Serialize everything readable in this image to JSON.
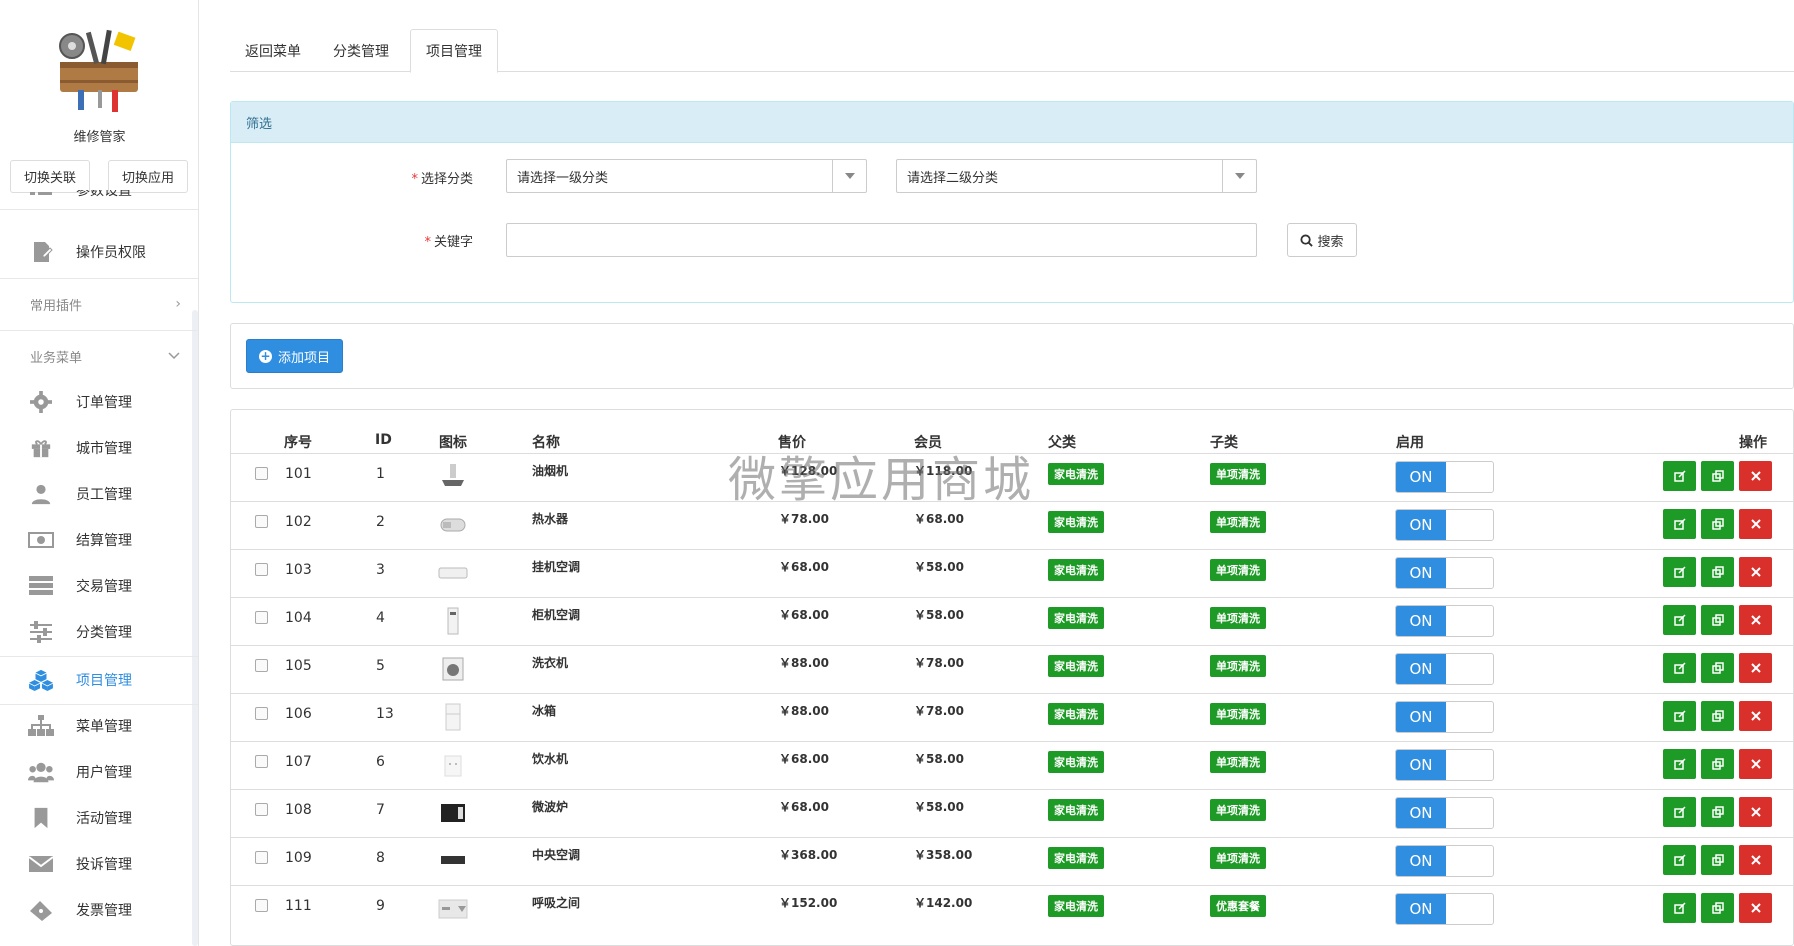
{
  "app": {
    "name": "维修管家"
  },
  "sidebar": {
    "switch_link_label": "切换关联",
    "switch_app_label": "切换应用",
    "partial_label": "参数设置",
    "top_items": [
      {
        "label": "操作员权限",
        "icon": "document-edit-icon"
      }
    ],
    "group_plugins": "常用插件",
    "group_business": "业务菜单",
    "items": [
      {
        "label": "订单管理",
        "icon": "gear-icon"
      },
      {
        "label": "城市管理",
        "icon": "gift-icon"
      },
      {
        "label": "员工管理",
        "icon": "user-icon"
      },
      {
        "label": "结算管理",
        "icon": "money-icon"
      },
      {
        "label": "交易管理",
        "icon": "server-icon"
      },
      {
        "label": "分类管理",
        "icon": "sliders-icon"
      },
      {
        "label": "项目管理",
        "icon": "cubes-icon"
      },
      {
        "label": "菜单管理",
        "icon": "sitemap-icon"
      },
      {
        "label": "用户管理",
        "icon": "users-icon"
      },
      {
        "label": "活动管理",
        "icon": "bookmark-icon"
      },
      {
        "label": "投诉管理",
        "icon": "envelope-icon"
      },
      {
        "label": "发票管理",
        "icon": "ticket-icon"
      }
    ],
    "active_color": "#2f8ee0"
  },
  "tabs": [
    "返回菜单",
    "分类管理",
    "项目管理"
  ],
  "filter": {
    "title": "筛选",
    "category_label": "选择分类",
    "category1_placeholder": "请选择一级分类",
    "category2_placeholder": "请选择二级分类",
    "keyword_label": "关键字",
    "keyword_value": "",
    "search_label": "搜索"
  },
  "actions": {
    "add_label": "添加项目"
  },
  "table": {
    "headers": {
      "seq": "序号",
      "id": "ID",
      "icon": "图标",
      "name": "名称",
      "price": "售价",
      "member": "会员",
      "parent": "父类",
      "child": "子类",
      "enabled": "启用",
      "ops": "操作"
    },
    "toggle_on": "ON",
    "rows": [
      {
        "seq": "101",
        "id": "1",
        "name": "油烟机",
        "price": "￥128.00",
        "member": "￥118.00",
        "parent": "家电清洗",
        "child": "单项清洗",
        "icon": "range-hood-icon"
      },
      {
        "seq": "102",
        "id": "2",
        "name": "热水器",
        "price": "￥78.00",
        "member": "￥68.00",
        "parent": "家电清洗",
        "child": "单项清洗",
        "icon": "water-heater-icon"
      },
      {
        "seq": "103",
        "id": "3",
        "name": "挂机空调",
        "price": "￥68.00",
        "member": "￥58.00",
        "parent": "家电清洗",
        "child": "单项清洗",
        "icon": "wall-ac-icon"
      },
      {
        "seq": "104",
        "id": "4",
        "name": "柜机空调",
        "price": "￥68.00",
        "member": "￥58.00",
        "parent": "家电清洗",
        "child": "单项清洗",
        "icon": "floor-ac-icon"
      },
      {
        "seq": "105",
        "id": "5",
        "name": "洗衣机",
        "price": "￥88.00",
        "member": "￥78.00",
        "parent": "家电清洗",
        "child": "单项清洗",
        "icon": "washer-icon"
      },
      {
        "seq": "106",
        "id": "13",
        "name": "冰箱",
        "price": "￥88.00",
        "member": "￥78.00",
        "parent": "家电清洗",
        "child": "单项清洗",
        "icon": "fridge-icon"
      },
      {
        "seq": "107",
        "id": "6",
        "name": "饮水机",
        "price": "￥68.00",
        "member": "￥58.00",
        "parent": "家电清洗",
        "child": "单项清洗",
        "icon": "water-dispenser-icon"
      },
      {
        "seq": "108",
        "id": "7",
        "name": "微波炉",
        "price": "￥68.00",
        "member": "￥58.00",
        "parent": "家电清洗",
        "child": "单项清洗",
        "icon": "microwave-icon"
      },
      {
        "seq": "109",
        "id": "8",
        "name": "中央空调",
        "price": "￥368.00",
        "member": "￥358.00",
        "parent": "家电清洗",
        "child": "单项清洗",
        "icon": "central-ac-icon"
      },
      {
        "seq": "111",
        "id": "9",
        "name": "呼吸之间",
        "price": "￥152.00",
        "member": "￥142.00",
        "parent": "家电清洗",
        "child": "优惠套餐",
        "icon": "air-purifier-icon"
      }
    ]
  },
  "watermark": "微擎应用商城",
  "colors": {
    "primary": "#2f8ee0",
    "green": "#1e9a26",
    "red": "#d9302c",
    "panel_head": "#d9edf7"
  }
}
